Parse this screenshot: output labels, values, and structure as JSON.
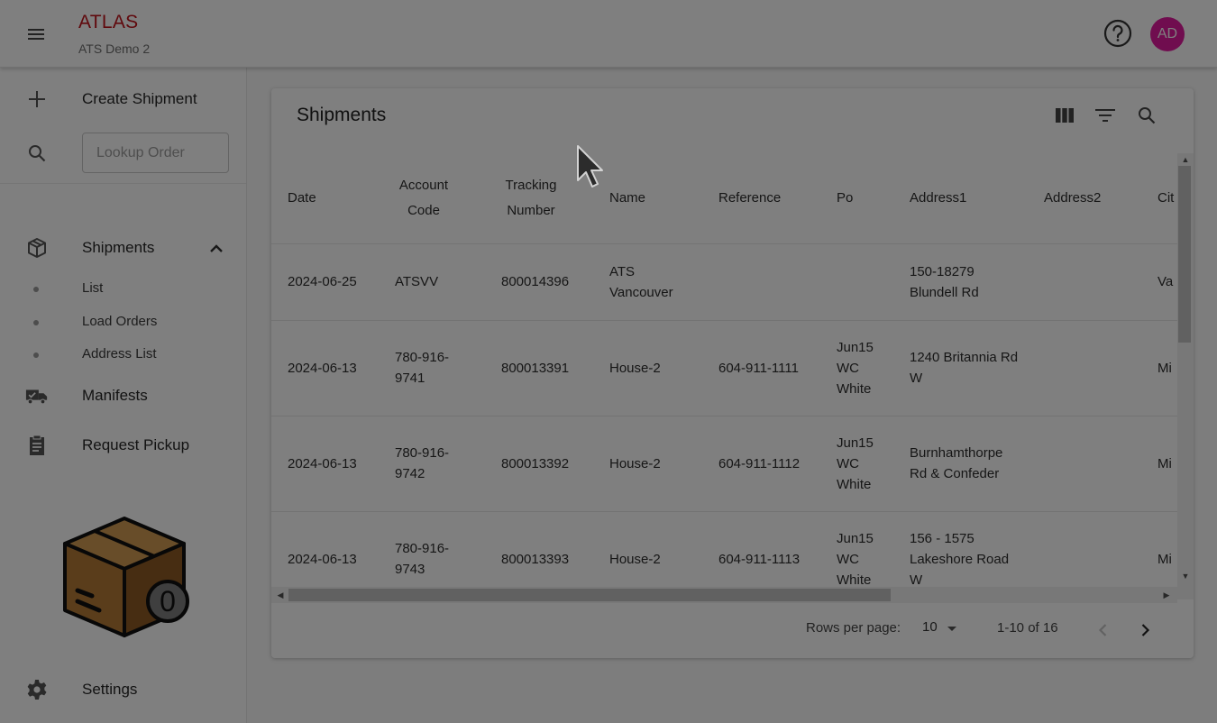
{
  "header": {
    "brand": "ATLAS",
    "subtitle": "ATS Demo 2",
    "menu_icon": "hamburger-menu-icon",
    "help_icon": "help-circle-icon",
    "avatar_initials": "AD",
    "brand_color": "#c0121a",
    "avatar_color": "#e01a9e"
  },
  "sidebar": {
    "create_label": "Create Shipment",
    "lookup_placeholder": "Lookup Order",
    "shipments_label": "Shipments",
    "sub_items": [
      "List",
      "Load Orders",
      "Address List"
    ],
    "manifests_label": "Manifests",
    "pickup_label": "Request Pickup",
    "settings_label": "Settings",
    "badge_count": "0"
  },
  "main": {
    "title": "Shipments",
    "toolbar_icons": [
      "view-columns-icon",
      "filter-icon",
      "search-icon"
    ],
    "columns": [
      {
        "line1": "Date",
        "line2": ""
      },
      {
        "line1": "Account",
        "line2": "Code"
      },
      {
        "line1": "Tracking",
        "line2": "Number"
      },
      {
        "line1": "Name",
        "line2": ""
      },
      {
        "line1": "Reference",
        "line2": ""
      },
      {
        "line1": "Po",
        "line2": ""
      },
      {
        "line1": "Address1",
        "line2": ""
      },
      {
        "line1": "Address2",
        "line2": ""
      },
      {
        "line1": "Cit",
        "line2": ""
      }
    ],
    "rows": [
      [
        "2024-06-25",
        "ATSVV",
        "800014396",
        "ATS Vancouver",
        "",
        "",
        "150-18279 Blundell Rd",
        "",
        "Va"
      ],
      [
        "2024-06-13",
        "780-916-9741",
        "800013391",
        "House-2",
        "604-911-1111",
        "Jun15 WC White",
        "1240 Britannia Rd W",
        "",
        "Mi"
      ],
      [
        "2024-06-13",
        "780-916-9742",
        "800013392",
        "House-2",
        "604-911-1112",
        "Jun15 WC White",
        "Burnhamthorpe Rd & Confeder",
        "",
        "Mi"
      ],
      [
        "2024-06-13",
        "780-916-9743",
        "800013393",
        "House-2",
        "604-911-1113",
        "Jun15 WC White",
        "156 - 1575 Lakeshore Road W",
        "",
        "Mi"
      ]
    ]
  },
  "pagination": {
    "rows_per_page_label": "Rows per page:",
    "rows_per_page": "10",
    "range": "1-10 of 16"
  }
}
